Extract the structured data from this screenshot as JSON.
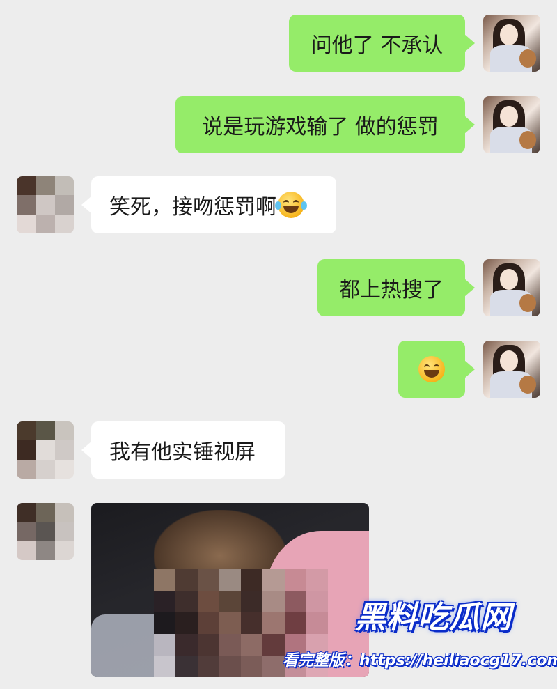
{
  "messages": [
    {
      "id": "m1",
      "text": "问他了 不承认"
    },
    {
      "id": "m2",
      "text": "说是玩游戏输了 做的惩罚"
    },
    {
      "id": "m3",
      "text": "笑死，接吻惩罚啊",
      "emoji": "tears-of-joy-emoji"
    },
    {
      "id": "m4",
      "text": "都上热搜了"
    },
    {
      "id": "m5",
      "emoji": "grinning-face-emoji"
    },
    {
      "id": "m6",
      "text": "我有他实锤视屏"
    },
    {
      "id": "m7",
      "attachment": "blurred-photo"
    }
  ],
  "watermark": {
    "title": "黑料吃瓜网",
    "prefix": "看完整版：",
    "url": "https://heiliaocg17.com"
  },
  "colors": {
    "background": "#ededed",
    "outgoing_bubble": "#95ec69",
    "incoming_bubble": "#ffffff",
    "watermark_stroke": "#0a2cc9"
  }
}
